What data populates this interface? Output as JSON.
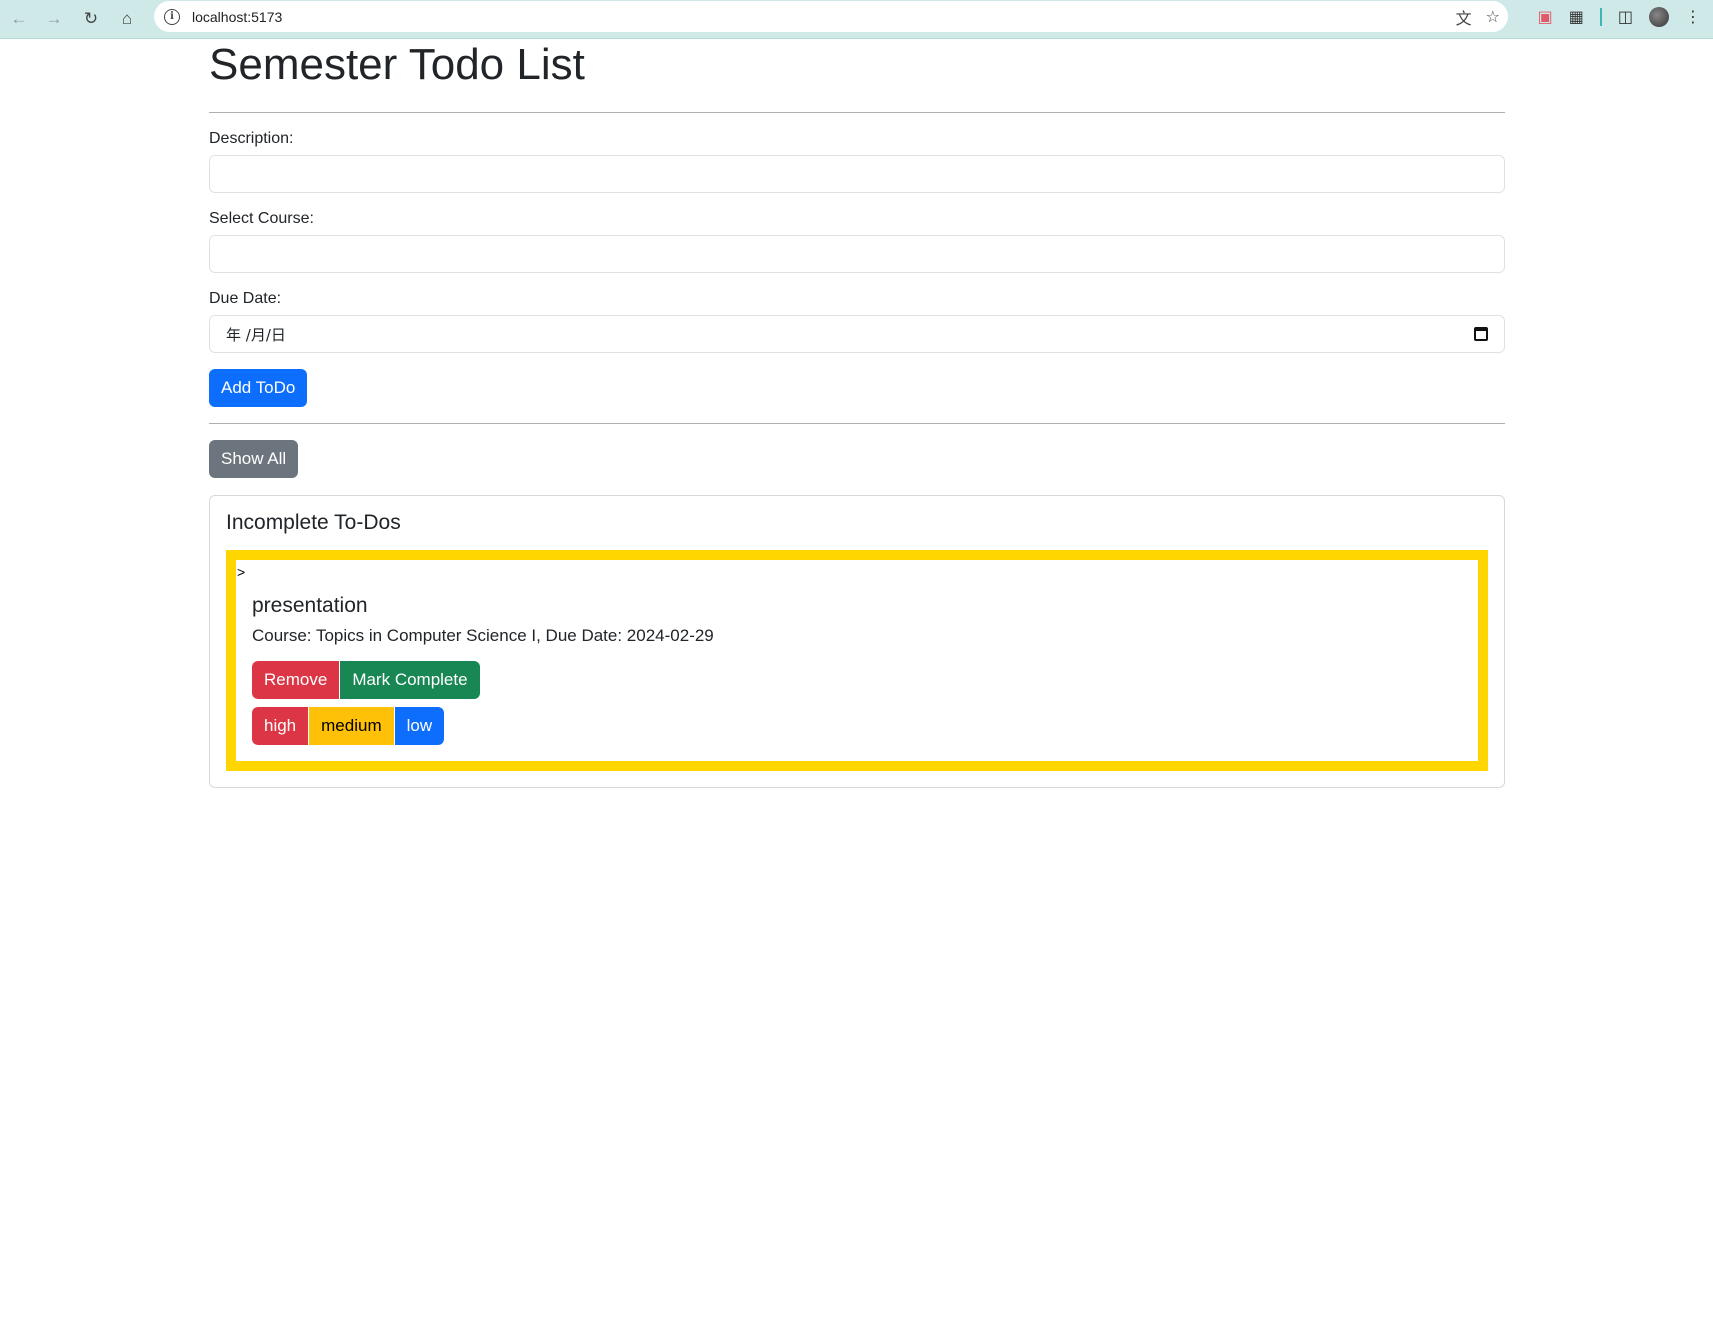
{
  "browser": {
    "url": "localhost:5173"
  },
  "page": {
    "title": "Semester Todo List"
  },
  "form": {
    "description_label": "Description:",
    "description_value": "",
    "course_label": "Select Course:",
    "course_value": "",
    "due_date_label": "Due Date:",
    "due_date_placeholder": "年 /月/日",
    "add_button_label": "Add ToDo"
  },
  "filter": {
    "show_all_label": "Show All"
  },
  "incomplete": {
    "heading": "Incomplete To-Dos",
    "items": [
      {
        "marker": ">",
        "title": "presentation",
        "meta": "Course: Topics in Computer Science I, Due Date: 2024-02-29",
        "remove_label": "Remove",
        "complete_label": "Mark Complete",
        "priority": {
          "high": "high",
          "medium": "medium",
          "low": "low"
        }
      }
    ]
  },
  "colors": {
    "highlight_border": "#ffd600",
    "primary": "#0d6efd",
    "secondary": "#6c757d",
    "danger": "#dc3545",
    "success": "#198754",
    "warning": "#ffc107"
  }
}
